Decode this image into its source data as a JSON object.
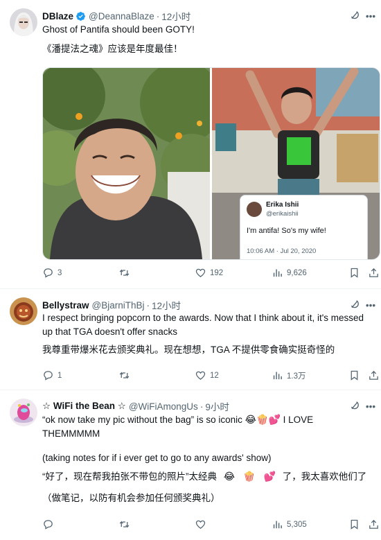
{
  "tweets": [
    {
      "name": "DBlaze",
      "handle": "@DeannaBlaze",
      "time": "12小时",
      "text_en": "Ghost of Pantifa should been GOTY!",
      "text_zh": "《潘提法之魂》应该是年度最佳！",
      "embedded": {
        "name": "Erika Ishii",
        "handle": "@erikaishii",
        "text": "I'm antifa! So's my wife!",
        "timestamp": "10:06 AM · Jul 20, 2020"
      },
      "stats": {
        "replies": "3",
        "retweets": "",
        "likes": "192",
        "views": "9,626"
      }
    },
    {
      "name": "Bellystraw",
      "handle": "@BjarniThBj",
      "time": "12小时",
      "text_en": "I respect bringing popcorn to the awards. Now that I think about it, it's messed up that TGA doesn't offer snacks",
      "text_zh": "我尊重带爆米花去颁奖典礼。现在想想，TGA 不提供零食确实挺奇怪的",
      "stats": {
        "replies": "1",
        "retweets": "",
        "likes": "12",
        "views": "1.3万"
      }
    },
    {
      "name": "☆ WiFi the Bean ☆",
      "handle": "@WiFiAmongUs",
      "time": "9小时",
      "text_en_1": "“ok now take my pic without the bag” is so iconic",
      "text_en_1b": "I LOVE THEMMMMM",
      "text_en_2": "(taking notes for if i ever get to go to any awards' show)",
      "text_zh_1": "“好了，现在帮我拍张不带包的照片”太经典",
      "text_zh_1b": "了，我太喜欢他们了",
      "text_zh_2": "（做笔记，以防有机会参加任何颁奖典礼）",
      "stats": {
        "replies": "",
        "retweets": "",
        "likes": "",
        "views": "5,305"
      }
    }
  ],
  "icons": {
    "reply": "reply-icon",
    "retweet": "retweet-icon",
    "like": "heart-icon",
    "views": "views-icon",
    "bookmark": "bookmark-icon",
    "share": "share-icon",
    "grok": "grok-icon",
    "more": "more-icon",
    "verified": "verified-badge-icon"
  },
  "colors": {
    "text": "#0f1419",
    "muted": "#536471",
    "verified": "#1d9bf0",
    "divider": "#eff3f4"
  }
}
